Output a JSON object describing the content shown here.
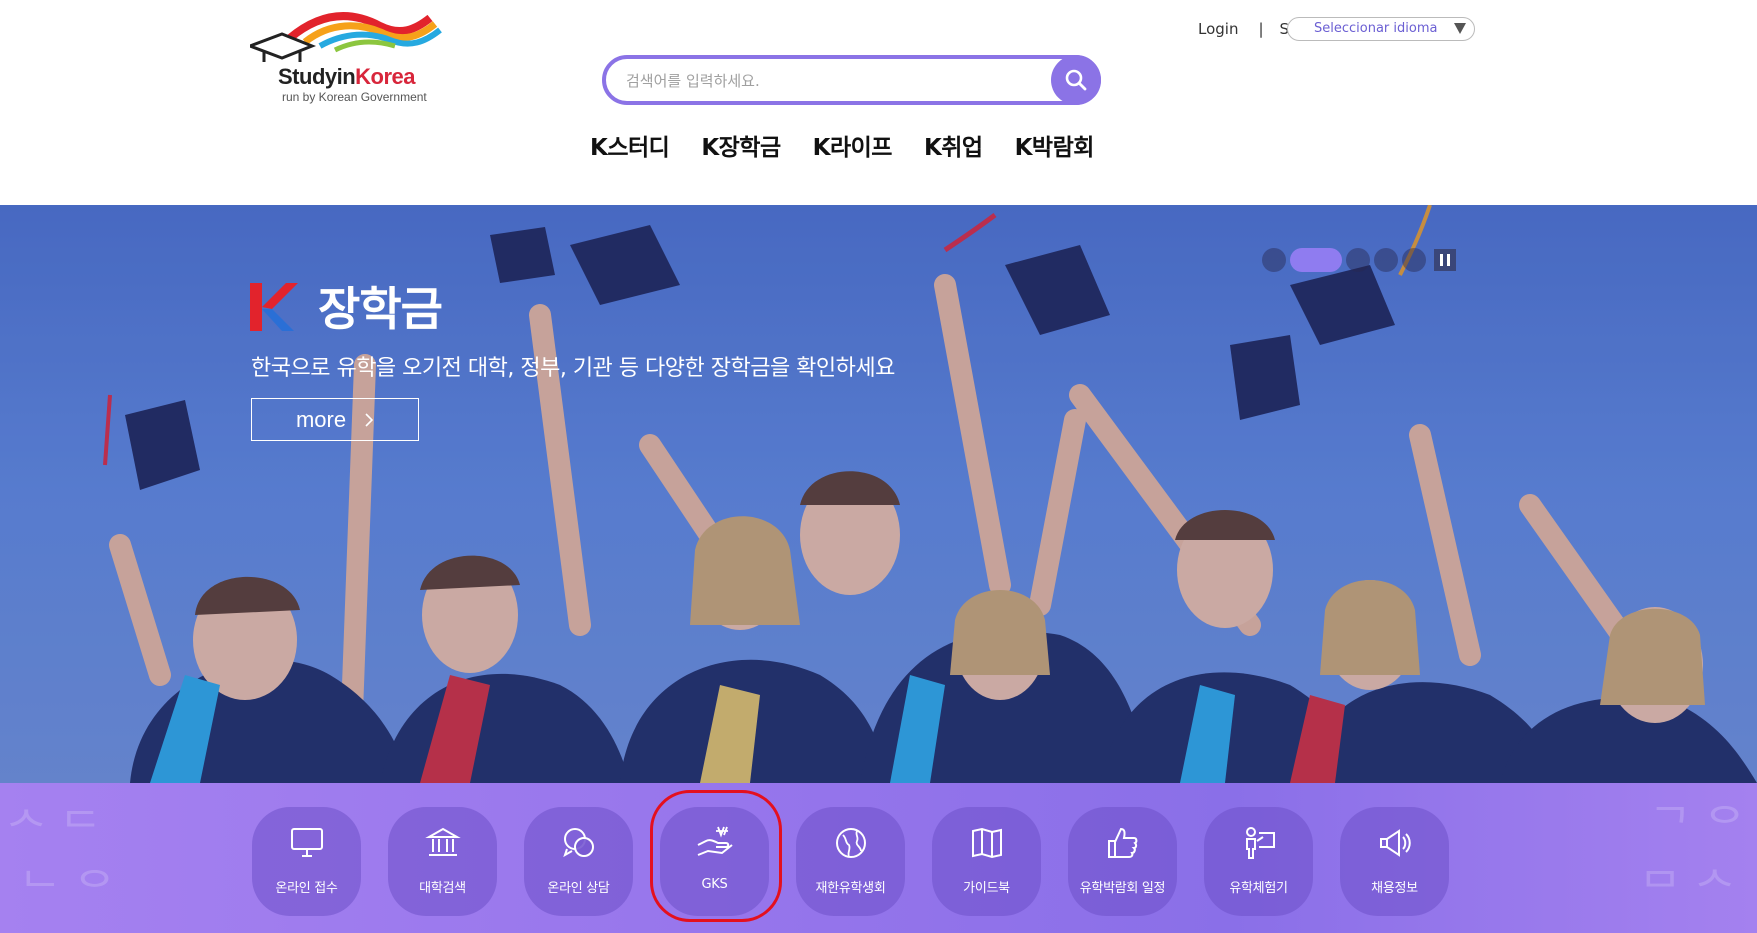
{
  "header": {
    "logo": {
      "brand_main": "Studyin",
      "brand_accent": "Korea",
      "tagline": "run by Korean Government"
    },
    "search": {
      "placeholder": "검색어를 입력하세요."
    },
    "top_links": {
      "login": "Login",
      "separator": "|",
      "truncated": "Si"
    },
    "language_select": {
      "selected": "Seleccionar idioma"
    },
    "nav": [
      {
        "label": "K스터디"
      },
      {
        "label": "K장학금"
      },
      {
        "label": "K라이프"
      },
      {
        "label": "K취업"
      },
      {
        "label": "K박람회"
      }
    ]
  },
  "hero": {
    "title": "장학금",
    "subtitle": "한국으로 유학을 오기전 대학, 정부, 기관 등 다양한 장학금을 확인하세요",
    "more_label": "more",
    "slides_total": 5,
    "active_slide": 2
  },
  "quick_menu": [
    {
      "label": "온라인 접수",
      "icon": "monitor-icon"
    },
    {
      "label": "대학검색",
      "icon": "university-icon"
    },
    {
      "label": "온라인 상담",
      "icon": "chat-bubbles-icon"
    },
    {
      "label": "GKS",
      "icon": "hand-won-icon",
      "highlighted": true
    },
    {
      "label": "재한유학생회",
      "icon": "globe-icon"
    },
    {
      "label": "가이드북",
      "icon": "book-icon"
    },
    {
      "label": "유학박람회 일정",
      "icon": "thumbs-up-icon"
    },
    {
      "label": "유학체험기",
      "icon": "presenter-icon"
    },
    {
      "label": "채용정보",
      "icon": "megaphone-icon"
    }
  ],
  "colors": {
    "accent": "#8b73e6",
    "quickbar": "#9776ec",
    "highlight_ring": "#e4101e",
    "sky": "#5680d2"
  }
}
